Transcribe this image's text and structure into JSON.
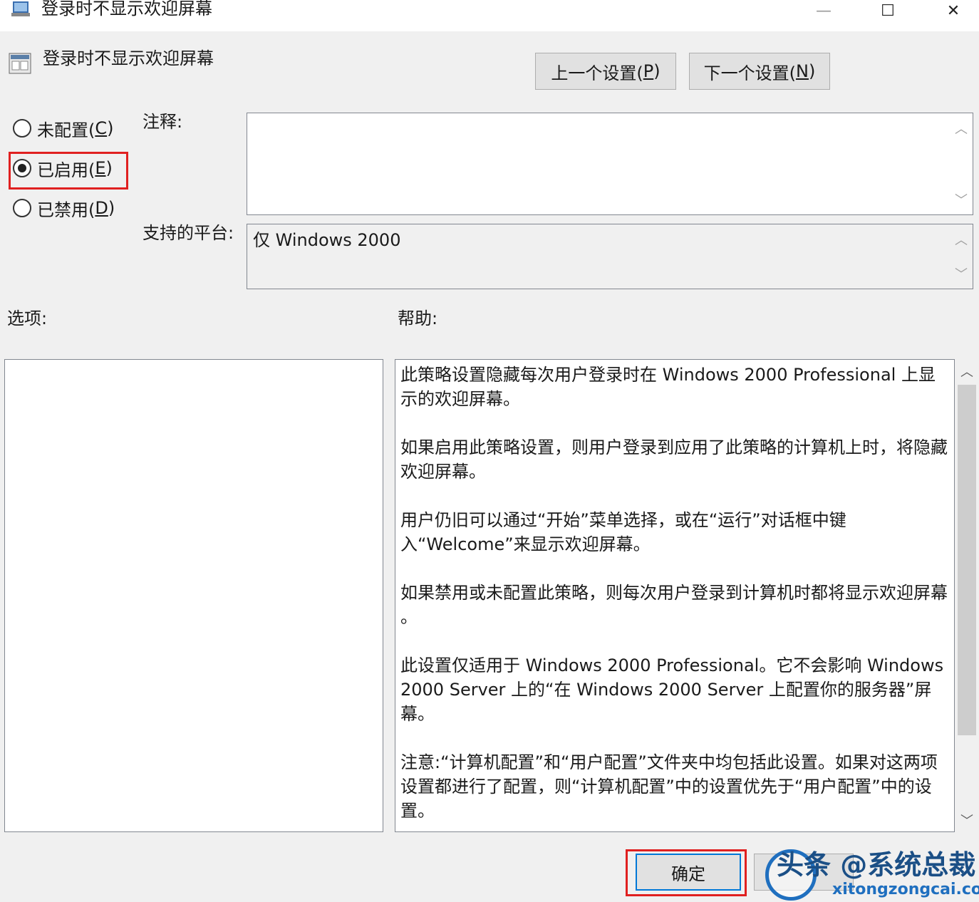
{
  "window": {
    "title": "登录时不显示欢迎屏幕",
    "minimize_glyph": "—",
    "maximize_glyph": "☐",
    "close_glyph": "✕"
  },
  "header": {
    "policy_title": "登录时不显示欢迎屏幕",
    "prev_setting_text": "上一个设置(",
    "prev_setting_key": "P",
    "prev_setting_end": ")",
    "next_setting_text": "下一个设置(",
    "next_setting_key": "N",
    "next_setting_end": ")"
  },
  "radios": [
    {
      "label": "未配置(",
      "key": "C",
      "end": ")",
      "selected": false
    },
    {
      "label": "已启用(",
      "key": "E",
      "end": ")",
      "selected": true
    },
    {
      "label": "已禁用(",
      "key": "D",
      "end": ")",
      "selected": false
    }
  ],
  "comment": {
    "label": "注释:",
    "value": ""
  },
  "platform": {
    "label": "支持的平台:",
    "value": "仅 Windows 2000"
  },
  "options": {
    "label": "选项:"
  },
  "help": {
    "label": "帮助:",
    "paragraphs": [
      "此策略设置隐藏每次用户登录时在 Windows 2000 Professional 上显示的欢迎屏幕。",
      "如果启用此策略设置，则用户登录到应用了此策略的计算机上时，将隐藏欢迎屏幕。",
      "用户仍旧可以通过“开始”菜单选择，或在“运行”对话框中键\n入“Welcome”来显示欢迎屏幕。",
      "如果禁用或未配置此策略，则每次用户登录到计算机时都将显示欢迎屏幕\n。",
      "此设置仅适用于 Windows 2000 Professional。它不会影响 Windows 2000 Server 上的“在 Windows 2000 Server 上配置你的服务器”屏幕。",
      "注意:“计算机配置”和“用户配置”文件夹中均包括此设置。如果对这两项设置都进行了配置，则“计算机配置”中的设置优先于“用户配置”中的设置。"
    ]
  },
  "footer": {
    "ok_label": "确定"
  },
  "watermark": {
    "text": "头条 @系统总裁",
    "subtext": "xitongzongcai.com"
  },
  "colors": {
    "highlight": "#e02020",
    "accent": "#0078d7",
    "background": "#f0f0f0"
  }
}
